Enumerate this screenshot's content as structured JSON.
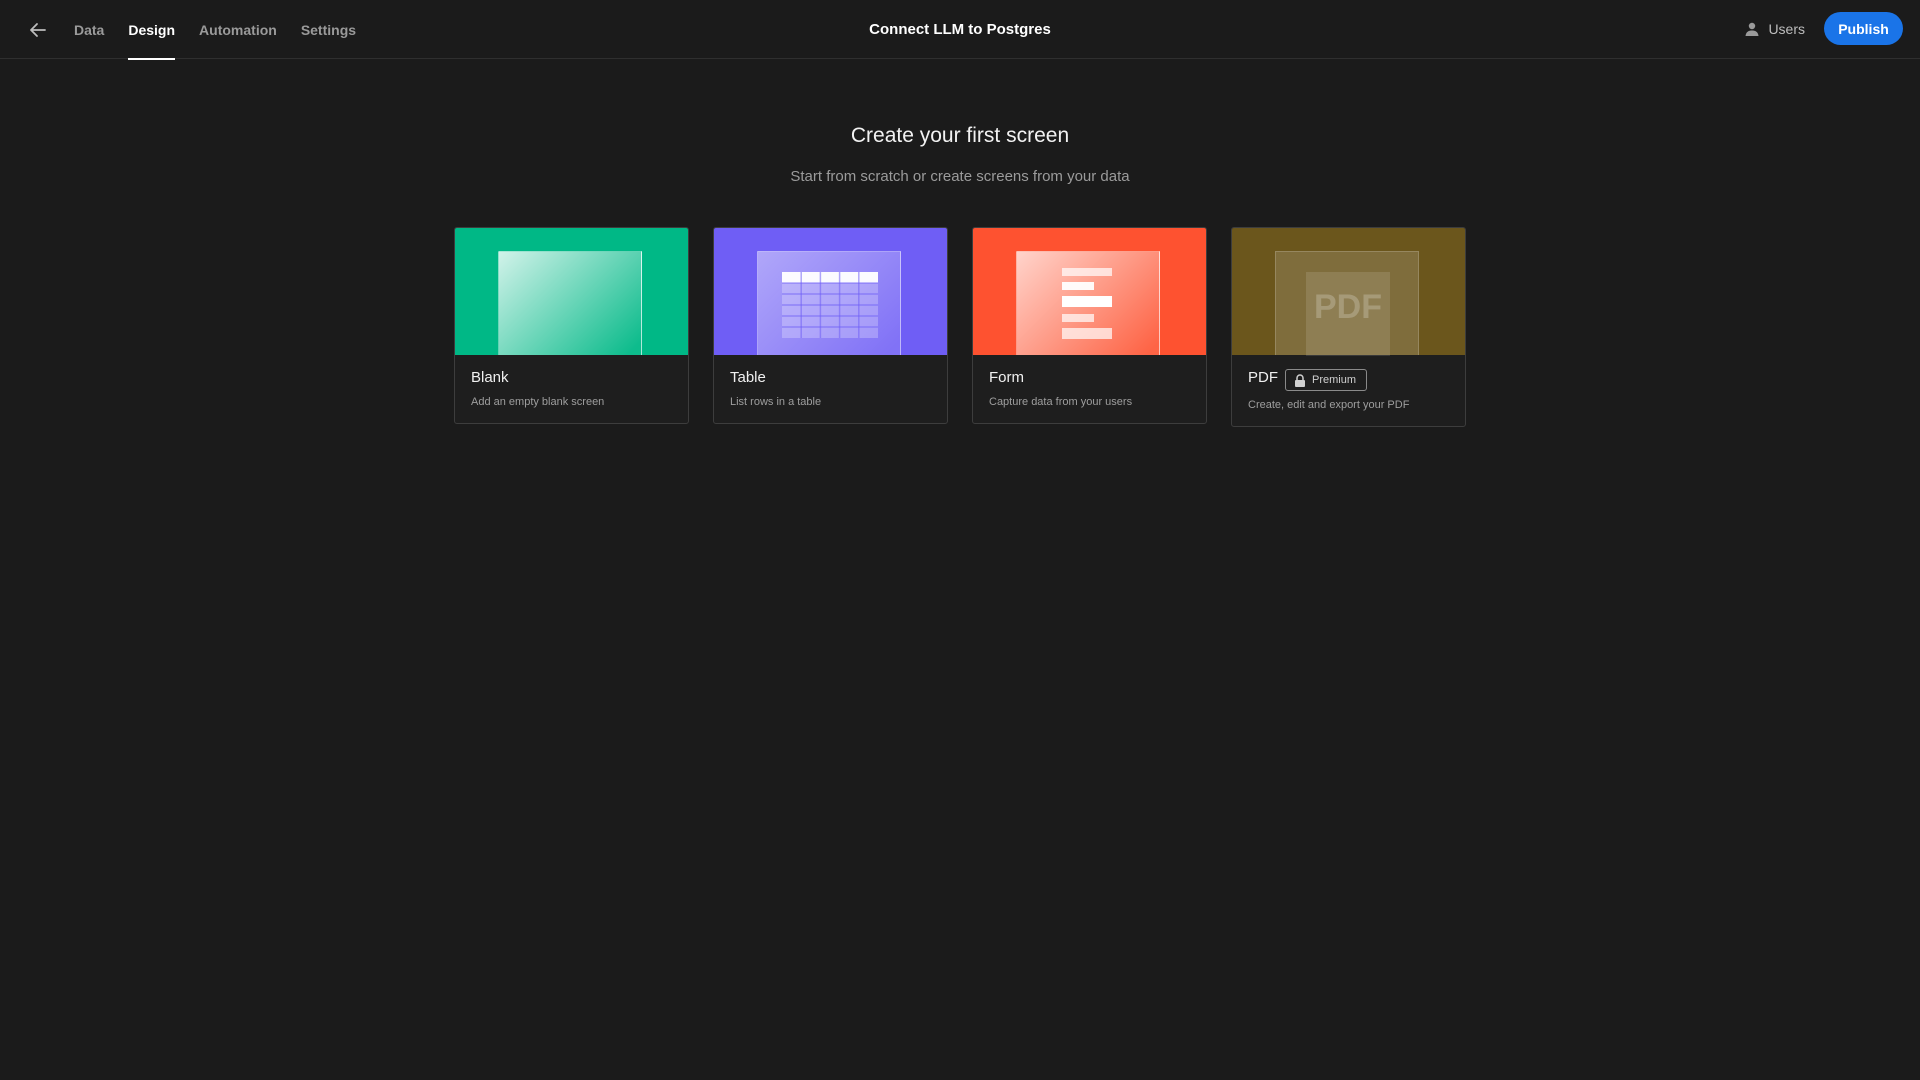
{
  "nav": {
    "tabs": [
      {
        "label": "Data",
        "active": false
      },
      {
        "label": "Design",
        "active": true
      },
      {
        "label": "Automation",
        "active": false
      },
      {
        "label": "Settings",
        "active": false
      }
    ]
  },
  "app": {
    "title": "Connect LLM to Postgres"
  },
  "header": {
    "users_label": "Users",
    "publish_label": "Publish"
  },
  "main": {
    "heading": "Create your first screen",
    "subheading": "Start from scratch or create screens from your data"
  },
  "cards": [
    {
      "title": "Blank",
      "description": "Add an empty blank screen",
      "color": "#00b886"
    },
    {
      "title": "Table",
      "description": "List rows in a table",
      "color": "#6f5ef5"
    },
    {
      "title": "Form",
      "description": "Capture data from your users",
      "color": "#fe5230"
    },
    {
      "title": "PDF",
      "badge": "Premium",
      "description": "Create, edit and export your PDF",
      "color": "#6b561c",
      "image_text": "PDF"
    }
  ],
  "colors": {
    "background": "#1b1b1b",
    "accent": "#1a74e8"
  },
  "icons": {
    "back": "arrow-left-icon",
    "users": "user-icon",
    "lock": "lock-icon"
  }
}
